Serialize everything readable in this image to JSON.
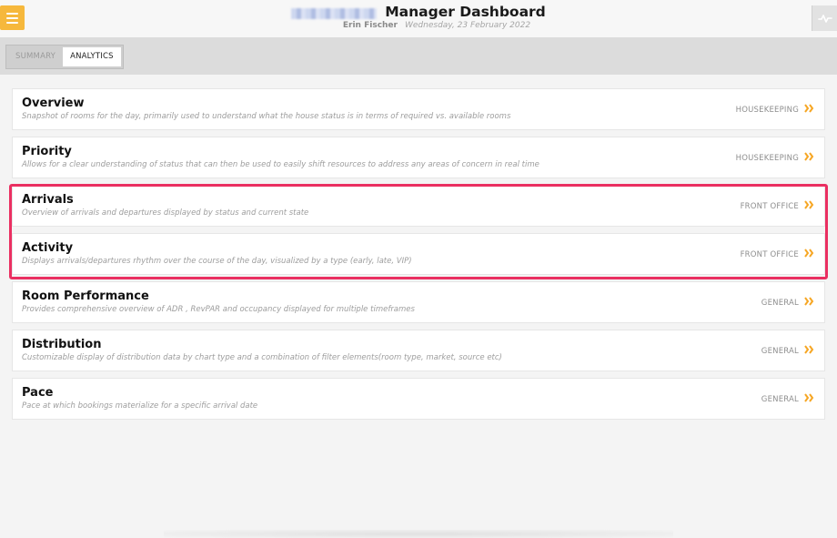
{
  "header": {
    "title": "Manager Dashboard",
    "user": "Erin Fischer",
    "date": "Wednesday, 23 February 2022",
    "menu_icon": "hamburger-menu-icon",
    "activity_icon": "activity-pulse-icon"
  },
  "tabs": [
    {
      "label": "SUMMARY",
      "active": false
    },
    {
      "label": "ANALYTICS",
      "active": true
    }
  ],
  "items": [
    {
      "name": "Overview",
      "description": "Snapshot of rooms for the day, primarily used to understand what the house status is in terms of required vs. available rooms",
      "category": "HOUSEKEEPING"
    },
    {
      "name": "Priority",
      "description": "Allows for a clear understanding of status that can then be used to easily shift resources to address any areas of concern in real time",
      "category": "HOUSEKEEPING"
    },
    {
      "name": "Arrivals",
      "description": "Overview of arrivals and departures displayed by status and current state",
      "category": "FRONT OFFICE"
    },
    {
      "name": "Activity",
      "description": "Displays arrivals/departures rhythm over the course of the day, visualized by a type (early, late, VIP)",
      "category": "FRONT OFFICE"
    },
    {
      "name": "Room Performance",
      "description": "Provides comprehensive overview of ADR , RevPAR and occupancy displayed for multiple timeframes",
      "category": "GENERAL"
    },
    {
      "name": "Distribution",
      "description": "Customizable display of distribution data by chart type and a combination of filter elements(room type, market, source etc)",
      "category": "GENERAL"
    },
    {
      "name": "Pace",
      "description": "Pace at which bookings materialize for a specific arrival date",
      "category": "GENERAL"
    }
  ],
  "colors": {
    "accent": "#f6b83c",
    "highlight": "#ea2f61"
  }
}
